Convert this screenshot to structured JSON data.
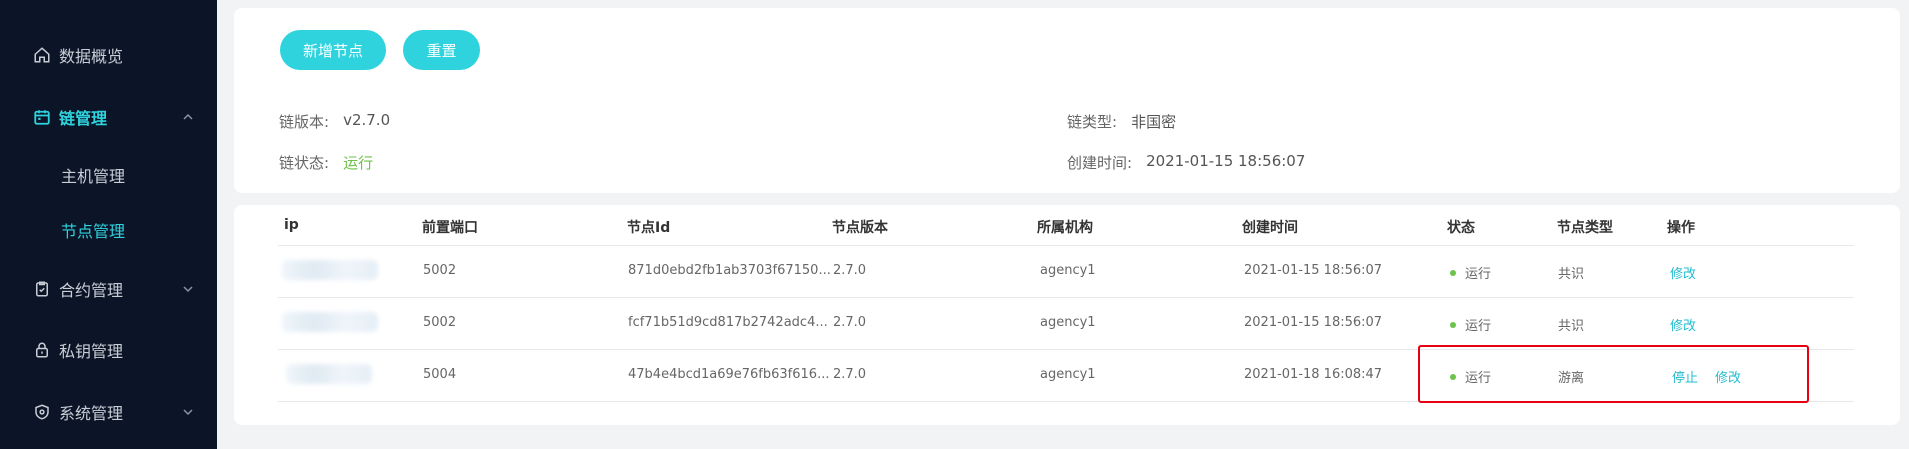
{
  "sidebar": {
    "items": [
      {
        "label": "数据概览"
      },
      {
        "label": "链管理"
      },
      {
        "label": "合约管理"
      },
      {
        "label": "私钥管理"
      },
      {
        "label": "系统管理"
      }
    ],
    "sub_items": [
      {
        "label": "主机管理"
      },
      {
        "label": "节点管理"
      }
    ]
  },
  "toolbar": {
    "add_label": "新增节点",
    "reset_label": "重置"
  },
  "chain_info": {
    "version_key": "链版本:",
    "version_value": "v2.7.0",
    "type_key": "链类型:",
    "type_value": "非国密",
    "status_key": "链状态:",
    "status_value": "运行",
    "created_key": "创建时间:",
    "created_value": "2021-01-15 18:56:07"
  },
  "table": {
    "headers": [
      "ip",
      "前置端口",
      "节点Id",
      "节点版本",
      "所属机构",
      "创建时间",
      "状态",
      "节点类型",
      "操作"
    ],
    "rows": [
      {
        "port": "5002",
        "node_id": "871d0ebd2fb1ab3703f67150...",
        "version": "2.7.0",
        "agency": "agency1",
        "created": "2021-01-15 18:56:07",
        "status": "运行",
        "type": "共识",
        "action_edit": "修改"
      },
      {
        "port": "5002",
        "node_id": "fcf71b51d9cd817b2742adc4...",
        "version": "2.7.0",
        "agency": "agency1",
        "created": "2021-01-15 18:56:07",
        "status": "运行",
        "type": "共识",
        "action_edit": "修改"
      },
      {
        "port": "5004",
        "node_id": "47b4e4bcd1a69e76fb63f616...",
        "version": "2.7.0",
        "agency": "agency1",
        "created": "2021-01-18 16:08:47",
        "status": "运行",
        "type": "游离",
        "action_stop": "停止",
        "action_edit": "修改"
      }
    ]
  },
  "colors": {
    "accent": "#2ed3dd",
    "sidebar_bg": "#0c1527",
    "running": "#6cc24a",
    "highlight": "#e60012"
  }
}
